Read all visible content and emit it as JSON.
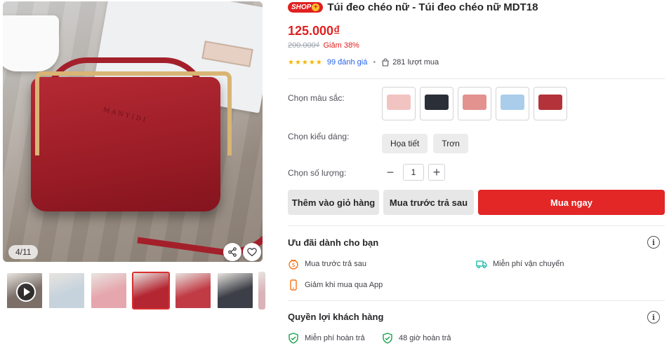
{
  "gallery": {
    "counter": "4/11",
    "brand_text": "MANYIDI",
    "thumbnails": [
      {
        "kind": "video",
        "color": "#7b6f68"
      },
      {
        "kind": "image",
        "color": "#c7d3dc"
      },
      {
        "kind": "image",
        "color": "#e6a6ad"
      },
      {
        "kind": "image",
        "color": "#b42632"
      },
      {
        "kind": "image",
        "color": "#c13b45"
      },
      {
        "kind": "image",
        "color": "#3c3f47"
      },
      {
        "kind": "image",
        "color": "#d9b3b7"
      }
    ]
  },
  "product": {
    "badge": "SHOP",
    "title": "Túi đeo chéo nữ - Túi đeo chéo nữ MDT18",
    "price": "125.000₫",
    "old_price": "200.000₫",
    "discount": "Giảm 38%",
    "stars": "★★★★★",
    "reviews": "99 đánh giá",
    "sold": "281 lượt mua"
  },
  "options": {
    "color_label": "Chọn màu sắc:",
    "colors": [
      "#f2c4c1",
      "#2b2f38",
      "#e3928f",
      "#a9cdea",
      "#b4323a"
    ],
    "style_label": "Chọn kiểu dáng:",
    "styles": [
      "Họa tiết",
      "Trơn"
    ],
    "qty_label": "Chọn số lượng:",
    "qty": "1"
  },
  "actions": {
    "add_to_cart": "Thêm vào giỏ hàng",
    "buy_later": "Mua trước trả sau",
    "buy_now": "Mua ngay"
  },
  "offers": {
    "title": "Ưu đãi dành cho bạn",
    "items": [
      "Mua trước trả sau",
      "Miễn phí vận chuyển",
      "Giảm khi mua qua App"
    ]
  },
  "rights": {
    "title": "Quyền lợi khách hàng",
    "items": [
      "Miễn phí hoàn trả",
      "48 giờ hoàn trả"
    ]
  },
  "colors": {
    "accent": "#e02020",
    "link": "#2563eb",
    "star": "#f5b700"
  }
}
